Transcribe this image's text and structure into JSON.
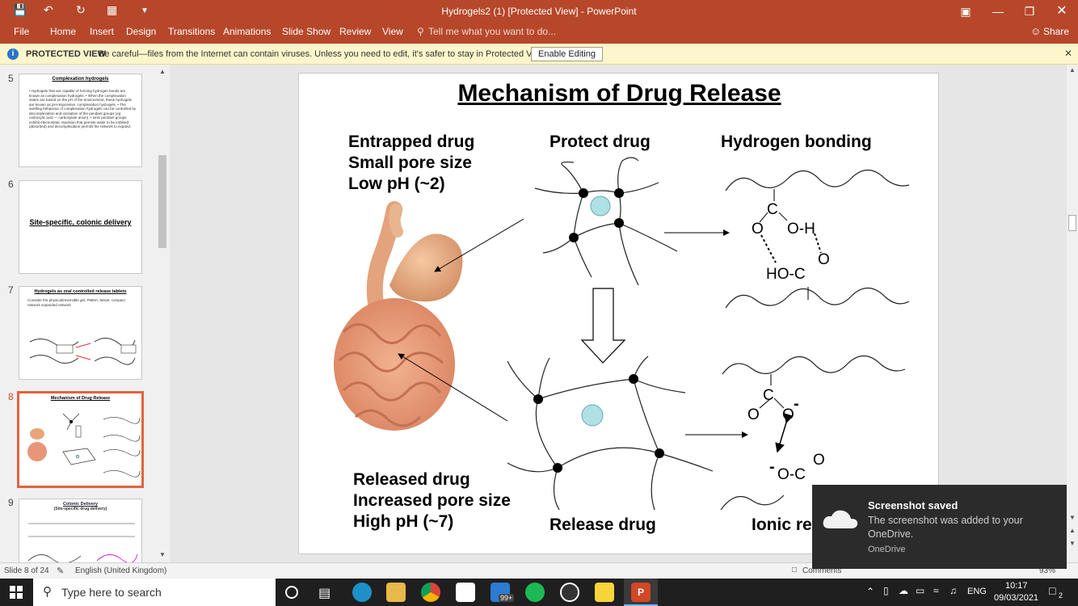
{
  "window": {
    "title": "Hydrogels2 (1) [Protected View] - PowerPoint"
  },
  "ribbon": {
    "tabs": [
      "File",
      "Home",
      "Insert",
      "Design",
      "Transitions",
      "Animations",
      "Slide Show",
      "Review",
      "View"
    ],
    "tell_me": "Tell me what you want to do...",
    "share": "Share"
  },
  "protected_view": {
    "title": "PROTECTED VIEW",
    "message": "Be careful—files from the Internet can contain viruses. Unless you need to edit, it's safer to stay in Protected View.",
    "button": "Enable Editing"
  },
  "thumbnails": [
    {
      "num": "5",
      "title": "Complexation hydrogels",
      "text": "• Hydrogels that are capable of forming hydrogen bonds are known as complexation hydrogels. • When the complexation states are based on the pH of the environment, these hydrogels are known as pH-responsive, complexation hydrogels. • The swelling behaviour of complexation hydrogels can be controlled by decomplexation and ionisation of the pendant groups (eg carboxylic acid — carboxylate anion). • Ionic pendant groups exhibit electrostatic repulsion that permits water to be imbibed (absorbed) and decomplexation permits the network to expand."
    },
    {
      "num": "6",
      "title": "Site-specific, colonic delivery",
      "text": ""
    },
    {
      "num": "7",
      "title": "Hydrogels as oral controlled release tablets",
      "text": "Consider the physical/reversible gel, PMMA, below: compact network   expanded network"
    },
    {
      "num": "8",
      "title": "Mechanism of Drug Release",
      "text": ""
    },
    {
      "num": "9",
      "title": "Colonic Delivery",
      "text": "(Site-specific drug delivery)"
    }
  ],
  "slide": {
    "title": "Mechanism of Drug Release ",
    "top_left": [
      "Entrapped drug",
      "Small pore size",
      "Low pH (~2)"
    ],
    "protect_label": "Protect drug",
    "hbond_label": "Hydrogen bonding",
    "bottom_left": [
      "Released drug",
      "Increased pore size",
      "High pH (~7)"
    ],
    "release_label": "Release drug",
    "ionic_label": "Ionic re",
    "chem_top": {
      "c": "C",
      "o1": "O",
      "oh": "O-H",
      "ho_c": "HO-C",
      "o2": "O"
    },
    "chem_bottom": {
      "c": "C",
      "o1": "O",
      "o2": "O",
      "minus1": "-",
      "o_c": "O-C",
      "o3": "O",
      "minus2": "-"
    }
  },
  "status": {
    "slide_info": "Slide 8 of 24",
    "language": "English (United Kingdom)",
    "comments": "Comments",
    "zoom": "93%"
  },
  "taskbar": {
    "search_placeholder": "Type here to search",
    "badge": "99+",
    "lang": "ENG",
    "time": "10:17",
    "date": "09/03/2021",
    "notif_count": "2"
  },
  "toast": {
    "title": "Screenshot saved",
    "body": "The screenshot was added to your OneDrive.",
    "source": "OneDrive"
  },
  "colors": {
    "ppt_red": "#b7472a",
    "protected_bar": "#fdf6cc",
    "selected_thumb": "#e0643f",
    "particle": "#aee0e6"
  }
}
